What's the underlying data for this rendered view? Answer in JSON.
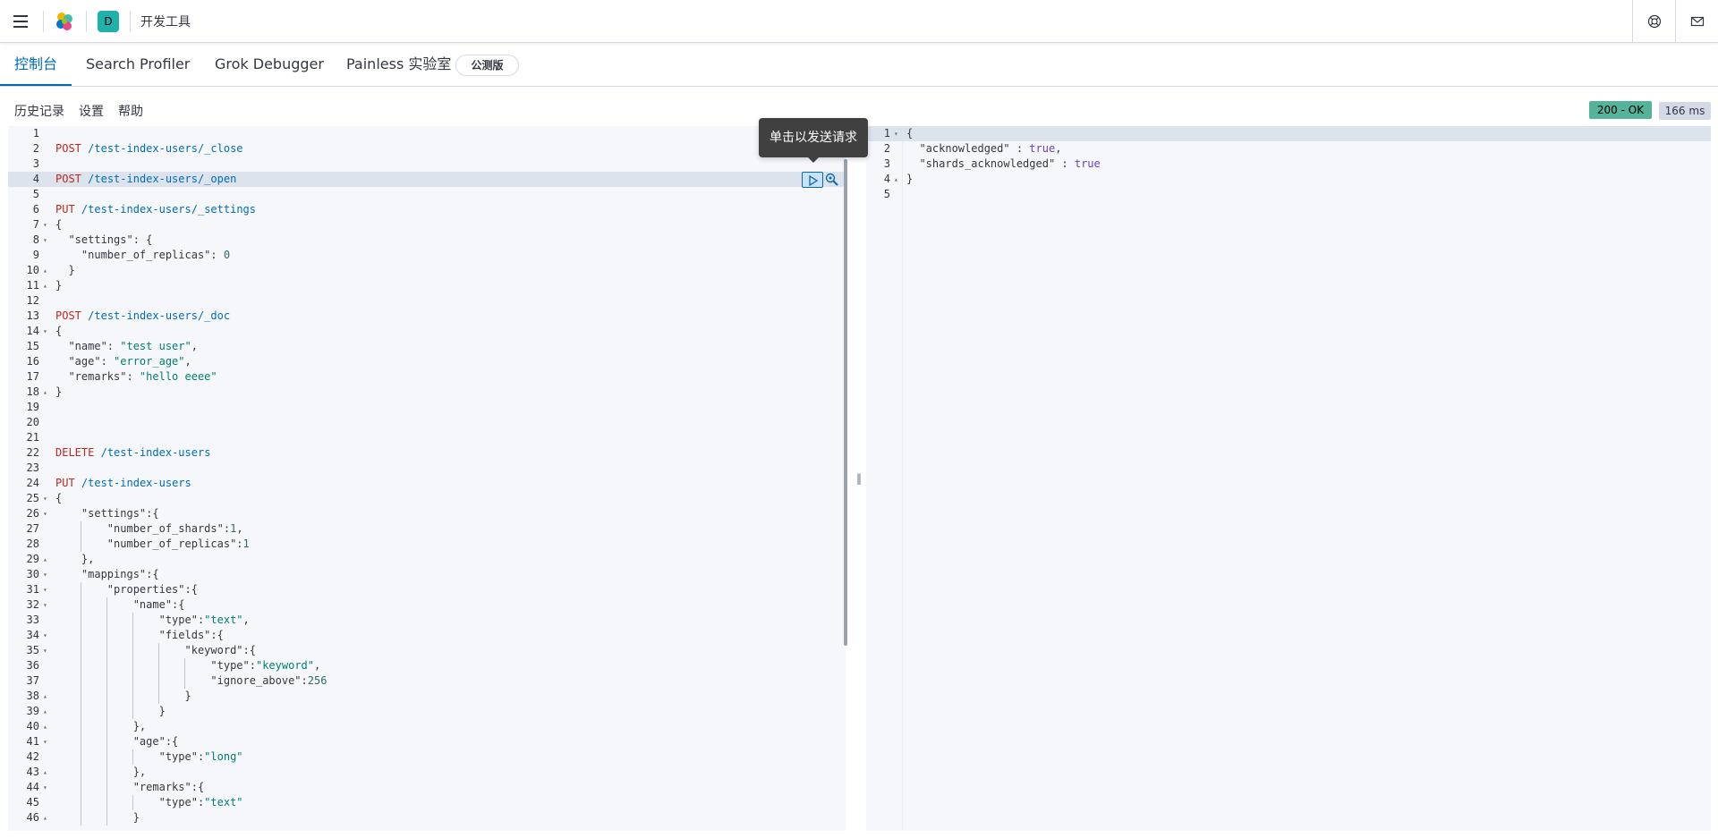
{
  "header": {
    "space_initial": "D",
    "app_title": "开发工具",
    "icons": [
      "menu-icon",
      "elastic-logo-icon",
      "help-icon",
      "mail-icon"
    ]
  },
  "tabs": [
    {
      "label": "控制台",
      "active": true
    },
    {
      "label": "Search Profiler",
      "active": false
    },
    {
      "label": "Grok Debugger",
      "active": false
    },
    {
      "label": "Painless 实验室",
      "active": false
    }
  ],
  "beta_badge": "公测版",
  "subbar": {
    "history": "历史记录",
    "settings": "设置",
    "help": "帮助"
  },
  "response_status": {
    "status": "200 - OK",
    "time": "166 ms"
  },
  "tooltip": "单击以发送请求",
  "request_editor": {
    "active_line": 4,
    "lines": [
      {
        "n": "1",
        "code": ""
      },
      {
        "n": "2",
        "code": "POST /test-index-users/_close"
      },
      {
        "n": "3",
        "code": ""
      },
      {
        "n": "4",
        "code": "POST /test-index-users/_open"
      },
      {
        "n": "5",
        "code": ""
      },
      {
        "n": "6",
        "code": "PUT /test-index-users/_settings"
      },
      {
        "n": "7",
        "code": "{"
      },
      {
        "n": "8",
        "code": "  \"settings\": {"
      },
      {
        "n": "9",
        "code": "    \"number_of_replicas\": 0"
      },
      {
        "n": "10",
        "code": "  }"
      },
      {
        "n": "11",
        "code": "}"
      },
      {
        "n": "12",
        "code": ""
      },
      {
        "n": "13",
        "code": "POST /test-index-users/_doc"
      },
      {
        "n": "14",
        "code": "{"
      },
      {
        "n": "15",
        "code": "  \"name\": \"test user\","
      },
      {
        "n": "16",
        "code": "  \"age\": \"error_age\","
      },
      {
        "n": "17",
        "code": "  \"remarks\": \"hello eeee\""
      },
      {
        "n": "18",
        "code": "}"
      },
      {
        "n": "19",
        "code": ""
      },
      {
        "n": "20",
        "code": ""
      },
      {
        "n": "21",
        "code": ""
      },
      {
        "n": "22",
        "code": "DELETE /test-index-users"
      },
      {
        "n": "23",
        "code": ""
      },
      {
        "n": "24",
        "code": "PUT /test-index-users"
      },
      {
        "n": "25",
        "code": "{"
      },
      {
        "n": "26",
        "code": "    \"settings\":{"
      },
      {
        "n": "27",
        "code": "        \"number_of_shards\":1,"
      },
      {
        "n": "28",
        "code": "        \"number_of_replicas\":1"
      },
      {
        "n": "29",
        "code": "    },"
      },
      {
        "n": "30",
        "code": "    \"mappings\":{"
      },
      {
        "n": "31",
        "code": "        \"properties\":{"
      },
      {
        "n": "32",
        "code": "            \"name\":{"
      },
      {
        "n": "33",
        "code": "                \"type\":\"text\","
      },
      {
        "n": "34",
        "code": "                \"fields\":{"
      },
      {
        "n": "35",
        "code": "                    \"keyword\":{"
      },
      {
        "n": "36",
        "code": "                        \"type\":\"keyword\","
      },
      {
        "n": "37",
        "code": "                        \"ignore_above\":256"
      },
      {
        "n": "38",
        "code": "                    }"
      },
      {
        "n": "39",
        "code": "                }"
      },
      {
        "n": "40",
        "code": "            },"
      },
      {
        "n": "41",
        "code": "            \"age\":{"
      },
      {
        "n": "42",
        "code": "                \"type\":\"long\""
      },
      {
        "n": "43",
        "code": "            },"
      },
      {
        "n": "44",
        "code": "            \"remarks\":{"
      },
      {
        "n": "45",
        "code": "                \"type\":\"text\""
      },
      {
        "n": "46",
        "code": "            }"
      }
    ]
  },
  "response_editor": {
    "lines": [
      {
        "n": "1",
        "code": "{"
      },
      {
        "n": "2",
        "code": "  \"acknowledged\" : true,"
      },
      {
        "n": "3",
        "code": "  \"shards_acknowledged\" : true"
      },
      {
        "n": "4",
        "code": "}"
      },
      {
        "n": "5",
        "code": ""
      }
    ]
  },
  "colors": {
    "accent": "#006bb4",
    "method": "#bd271e",
    "string": "#017d73",
    "boolean": "#6b3fbf",
    "status_ok": "#54b399"
  }
}
